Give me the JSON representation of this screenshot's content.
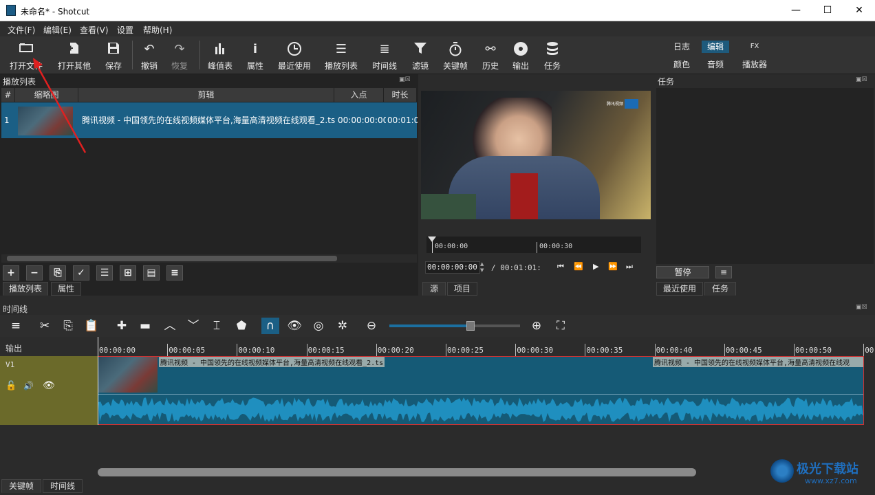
{
  "window": {
    "title": "未命名* - Shotcut",
    "minimize": "—",
    "maximize": "☐",
    "close": "✕"
  },
  "menu": [
    "文件(F)",
    "编辑(E)",
    "查看(V)",
    "设置",
    "帮助(H)"
  ],
  "toolbar": [
    {
      "label": "打开文件",
      "icon": "folder-open-icon"
    },
    {
      "label": "打开其他",
      "icon": "file-plus-icon"
    },
    {
      "label": "保存",
      "icon": "save-icon"
    },
    {
      "label": "撤销",
      "icon": "undo-icon"
    },
    {
      "label": "恢复",
      "icon": "redo-icon"
    },
    {
      "label": "峰值表",
      "icon": "peak-meter-icon"
    },
    {
      "label": "属性",
      "icon": "info-icon"
    },
    {
      "label": "最近使用",
      "icon": "clock-icon"
    },
    {
      "label": "播放列表",
      "icon": "list-icon"
    },
    {
      "label": "时间线",
      "icon": "timeline-icon"
    },
    {
      "label": "滤镜",
      "icon": "filter-icon"
    },
    {
      "label": "关键帧",
      "icon": "stopwatch-icon"
    },
    {
      "label": "历史",
      "icon": "history-icon"
    },
    {
      "label": "输出",
      "icon": "disc-icon"
    },
    {
      "label": "任务",
      "icon": "stack-icon"
    }
  ],
  "layouts": {
    "log": "日志",
    "edit": "编辑",
    "fx": "FX",
    "color": "颜色",
    "audio": "音频",
    "player": "播放器"
  },
  "playlist": {
    "panel_title": "播放列表",
    "columns": {
      "num": "#",
      "thumb": "缩略图",
      "clip": "剪辑",
      "in": "入点",
      "duration": "时长"
    },
    "rows": [
      {
        "num": "1",
        "clip": "腾讯视频 - 中国领先的在线视频媒体平台,海量高清视频在线观看_2.ts",
        "in": "00:00:00:00",
        "duration": "00:01:0"
      }
    ],
    "tabs": [
      "播放列表",
      "属性"
    ]
  },
  "viewer": {
    "ruler_labels": [
      "00:00:00",
      "00:00:30"
    ],
    "timecode": "00:00:00:00",
    "total": "/ 00:01:01:",
    "tabs": [
      "源",
      "项目"
    ],
    "overlay_logo": "腾讯视频"
  },
  "jobs": {
    "panel_title": "任务",
    "pause": "暂停",
    "tabs": [
      "最近使用",
      "任务"
    ]
  },
  "timeline": {
    "panel_title": "时间线",
    "output_label": "输出",
    "track_name": "V1",
    "ruler": [
      "00:00:00",
      "00:00:05",
      "00:00:10",
      "00:00:15",
      "00:00:20",
      "00:00:25",
      "00:00:30",
      "00:00:35",
      "00:00:40",
      "00:00:45",
      "00:00:50",
      "00:"
    ],
    "clip_title": "腾讯视频 - 中国领先的在线视频媒体平台,海量高清视频在线观看_2.ts",
    "clip_title_2": "腾讯视频 - 中国领先的在线视频媒体平台,海量高清视频在线观",
    "zoom_level": 0.62,
    "hscroll_fraction": 0.78,
    "bottom_tabs": [
      "关键帧",
      "时间线"
    ]
  },
  "watermark": "极光下载站",
  "watermark_url": "www.xz7.com"
}
